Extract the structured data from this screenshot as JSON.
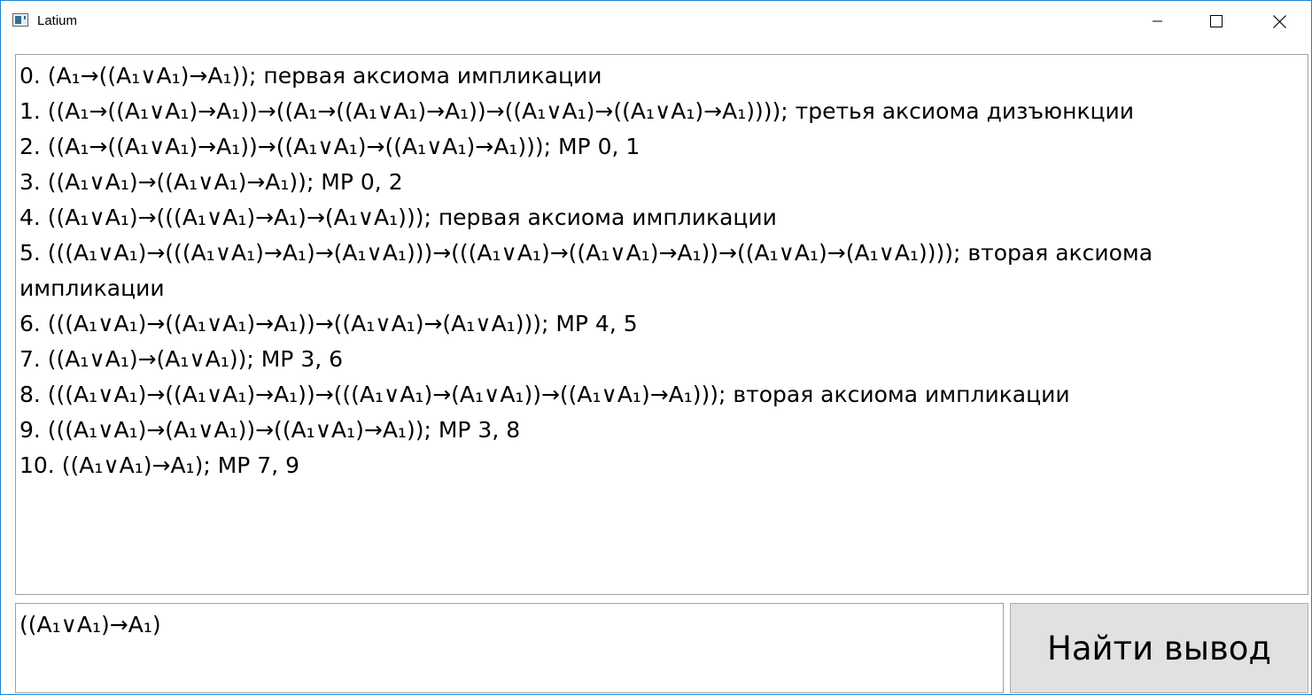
{
  "window": {
    "title": "Latium"
  },
  "output": {
    "lines": [
      "0. (A₁→((A₁∨A₁)→A₁)); первая аксиома импликации",
      "1. ((A₁→((A₁∨A₁)→A₁))→((A₁→((A₁∨A₁)→A₁))→((A₁∨A₁)→((A₁∨A₁)→A₁)))); третья аксиома дизъюнкции",
      "2. ((A₁→((A₁∨A₁)→A₁))→((A₁∨A₁)→((A₁∨A₁)→A₁))); MP 0, 1",
      "3. ((A₁∨A₁)→((A₁∨A₁)→A₁)); MP 0, 2",
      "4. ((A₁∨A₁)→(((A₁∨A₁)→A₁)→(A₁∨A₁))); первая аксиома импликации",
      "5. (((A₁∨A₁)→(((A₁∨A₁)→A₁)→(A₁∨A₁)))→(((A₁∨A₁)→((A₁∨A₁)→A₁))→((A₁∨A₁)→(A₁∨A₁)))); вторая аксиома импликации",
      "6. (((A₁∨A₁)→((A₁∨A₁)→A₁))→((A₁∨A₁)→(A₁∨A₁))); MP 4, 5",
      "7. ((A₁∨A₁)→(A₁∨A₁)); MP 3, 6",
      "8. (((A₁∨A₁)→((A₁∨A₁)→A₁))→(((A₁∨A₁)→(A₁∨A₁))→((A₁∨A₁)→A₁))); вторая аксиома импликации",
      "9. (((A₁∨A₁)→(A₁∨A₁))→((A₁∨A₁)→A₁)); MP 3, 8",
      "10. ((A₁∨A₁)→A₁); MP 7, 9"
    ]
  },
  "input": {
    "value": "((A₁∨A₁)→A₁)"
  },
  "button": {
    "label": "Найти вывод"
  },
  "icons": {
    "app": "window-app-icon",
    "minimize": "minimize-icon",
    "maximize": "maximize-icon",
    "close": "close-icon"
  }
}
